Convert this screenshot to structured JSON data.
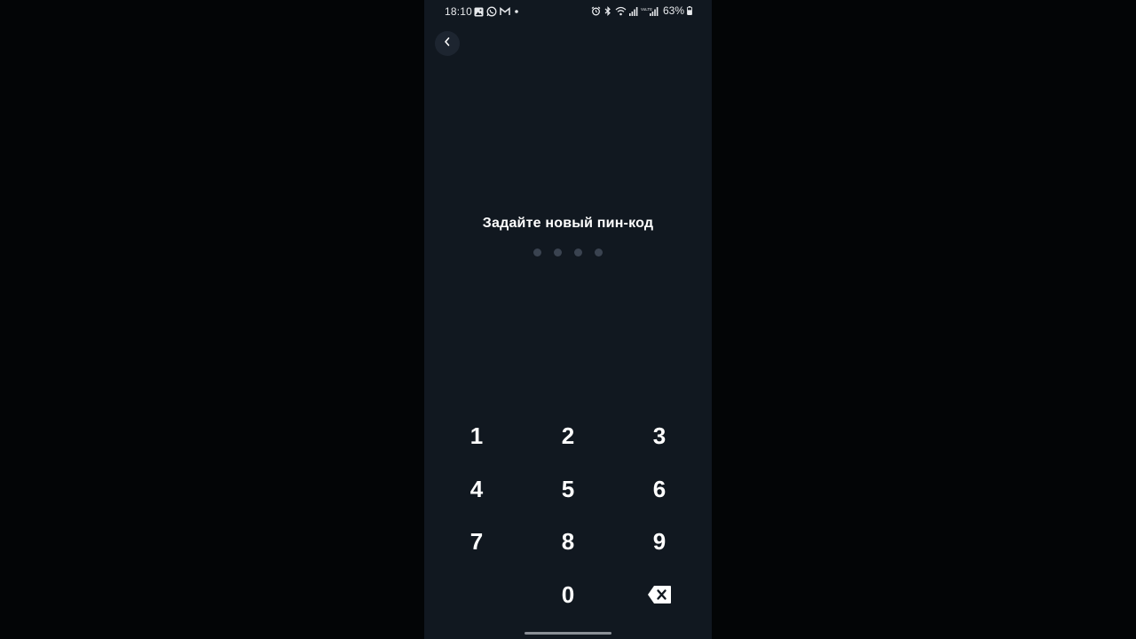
{
  "status_bar": {
    "time": "18:10",
    "battery": "63%",
    "left_icons": [
      "gallery-icon",
      "whatsapp-icon",
      "gmail-icon",
      "dot-icon"
    ],
    "right_icons": [
      "alarm-icon",
      "bluetooth-icon",
      "wifi-icon",
      "signal-icon",
      "volte-signal-icon",
      "battery-icon"
    ]
  },
  "header": {
    "back_icon": "chevron-left-icon"
  },
  "main": {
    "title": "Задайте новый пин-код",
    "pin_length": 4,
    "pin_filled": 0
  },
  "keypad": {
    "keys": [
      "1",
      "2",
      "3",
      "4",
      "5",
      "6",
      "7",
      "8",
      "9",
      "0"
    ],
    "backspace_icon": "backspace-icon"
  },
  "colors": {
    "background": "#111820",
    "outer_background": "#030506",
    "text": "#ffffff",
    "dot_empty": "#3a4350"
  }
}
